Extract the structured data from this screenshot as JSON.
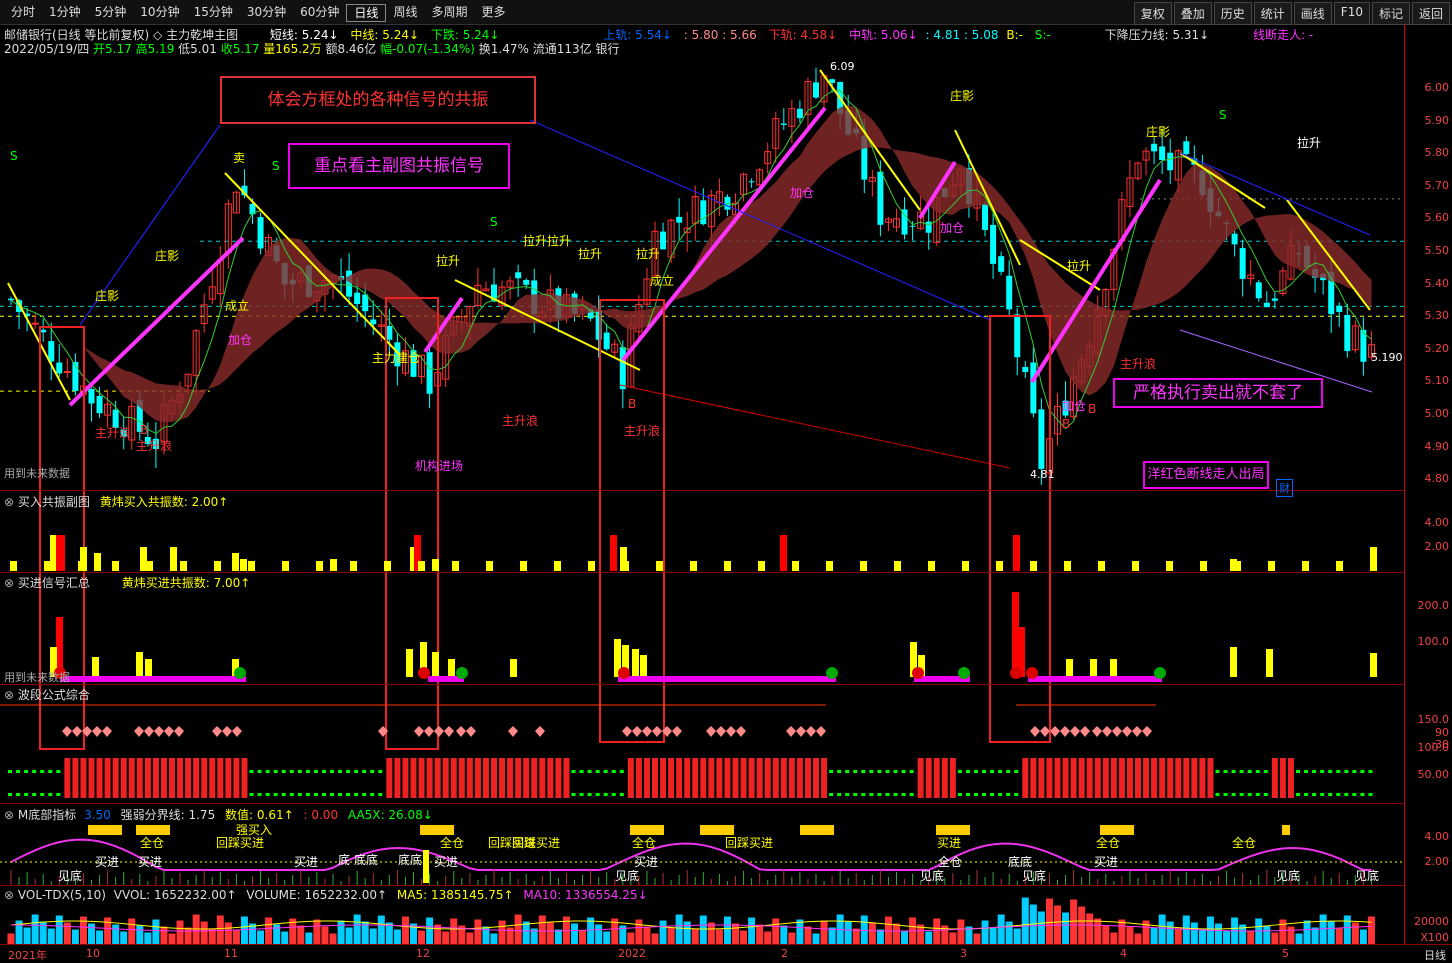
{
  "toolbar": {
    "periods": [
      "分时",
      "1分钟",
      "5分钟",
      "10分钟",
      "15分钟",
      "30分钟",
      "60分钟",
      "日线",
      "周线",
      "多周期",
      "更多"
    ],
    "active_period": "日线",
    "right_buttons": [
      "复权",
      "叠加",
      "历史",
      "统计",
      "画线",
      "F10",
      "标记",
      "返回"
    ]
  },
  "header": {
    "stock": "邮储银行(日线 等比前复权)",
    "indicator": "主力乾坤主图",
    "short_line": "短线: 5.24↓",
    "mid_line": "中线: 5.24↓",
    "down_line": "下跌: 5.24↓",
    "upper_rail": "上轨: 5.54↓",
    "rail_vals": ": 5.80 : 5.66",
    "lower_rail": "下轨: 4.58↓",
    "mid_rail": "中轨: 5.06↓",
    "mid_vals": ": 4.81 : 5.08",
    "b_label": "B:-",
    "s_label": "S:-",
    "pressure": "下降压力线: 5.31↓",
    "broken_line": "线断走人: -",
    "date": "2022/05/19/四",
    "open": "开5.17",
    "high": "高5.19",
    "low": "低5.01",
    "close": "收5.17",
    "volume": "量165.2万",
    "amount": "额8.46亿",
    "change": "幅-0.07(-1.34%)",
    "turnover": "换1.47%",
    "float": "流通113亿",
    "sector": "银行"
  },
  "price_axis": [
    "6.00",
    "5.90",
    "5.80",
    "5.70",
    "5.60",
    "5.50",
    "5.40",
    "5.30",
    "5.20",
    "5.10",
    "5.00",
    "4.90",
    "4.80"
  ],
  "annotations": {
    "box1": "体会方框处的各种信号的共振",
    "box2": "重点看主副图共振信号",
    "box3": "严格执行卖出就不套了",
    "box4": "洋红色断线走人出局",
    "last_price": "5.190",
    "high_mark": "6.09",
    "low_mark": "4.81",
    "future_data": "用到未来数据",
    "labels": [
      "庄影",
      "庄影",
      "加仓",
      "成立",
      "主力建仓",
      "拉升",
      "拉升",
      "拉升拉升",
      "拉升",
      "成立",
      "主升浪",
      "主升浪",
      "主升浪",
      "主升浪",
      "机构进场",
      "加仓",
      "加仓",
      "加仓",
      "主升浪",
      "拉升",
      "拉升",
      "庄影",
      "庄影",
      "卖",
      "S",
      "S",
      "S",
      "S",
      "B",
      "B",
      "B",
      "B"
    ],
    "fin_mark": "财"
  },
  "panels": {
    "p1_title": "买入共振副图",
    "p1_value": "黄炜买入共振数: 2.00↑",
    "p1_axis": [
      "4.00",
      "2.00"
    ],
    "p2_title": "买进信号汇总",
    "p2_value": "黄炜买进共振数: 7.00↑",
    "p2_axis": [
      "200.0",
      "100.0"
    ],
    "p2_future": "用到未来数据",
    "p3_title": "波段公式综合",
    "p3_axis": [
      "150.0",
      "100.0",
      "50.00"
    ],
    "p3_marks": [
      "90",
      ":30"
    ],
    "p4_title": "M底部指标",
    "p4_v1": "3.50",
    "p4_v2": "强弱分界线: 1.75",
    "p4_v3": "数值: 0.61↑",
    "p4_v4": ": 0.00",
    "p4_v5": "AA5X: 26.08↓",
    "p4_axis": [
      "4.00",
      "2.00"
    ],
    "p4_labels": [
      "见底",
      "买进",
      "买进",
      "全仓",
      "强买入",
      "回踩买进",
      "买进",
      "底",
      "底底",
      "底底",
      "买进",
      "全仓",
      "回踩买进",
      "回踩买进",
      "见底",
      "买进",
      "全仓",
      "回踩买进",
      "见底",
      "全仓",
      "买进",
      "底底",
      "见底",
      "买进",
      "全仓",
      "全仓",
      "见底",
      "见底"
    ],
    "p5_title": "VOL-TDX(5,10)",
    "p5_vvol": "VVOL: 1652232.00↑",
    "p5_volume": "VOLUME: 1652232.00↑",
    "p5_ma5": "MA5: 1385145.75↑",
    "p5_ma10": "MA10: 1336554.25↓",
    "p5_axis": [
      "20000"
    ],
    "p5_unit": "X100"
  },
  "xaxis": {
    "labels": [
      "2021年",
      "10",
      "11",
      "12",
      "2022",
      "2",
      "3",
      "4",
      "5"
    ],
    "right": "日线"
  },
  "colors": {
    "up": "#ff3030",
    "down": "#00ffff",
    "yellow": "#ffff00",
    "magenta": "#ff33ff",
    "green": "#00ff00",
    "grid": "#800000"
  }
}
